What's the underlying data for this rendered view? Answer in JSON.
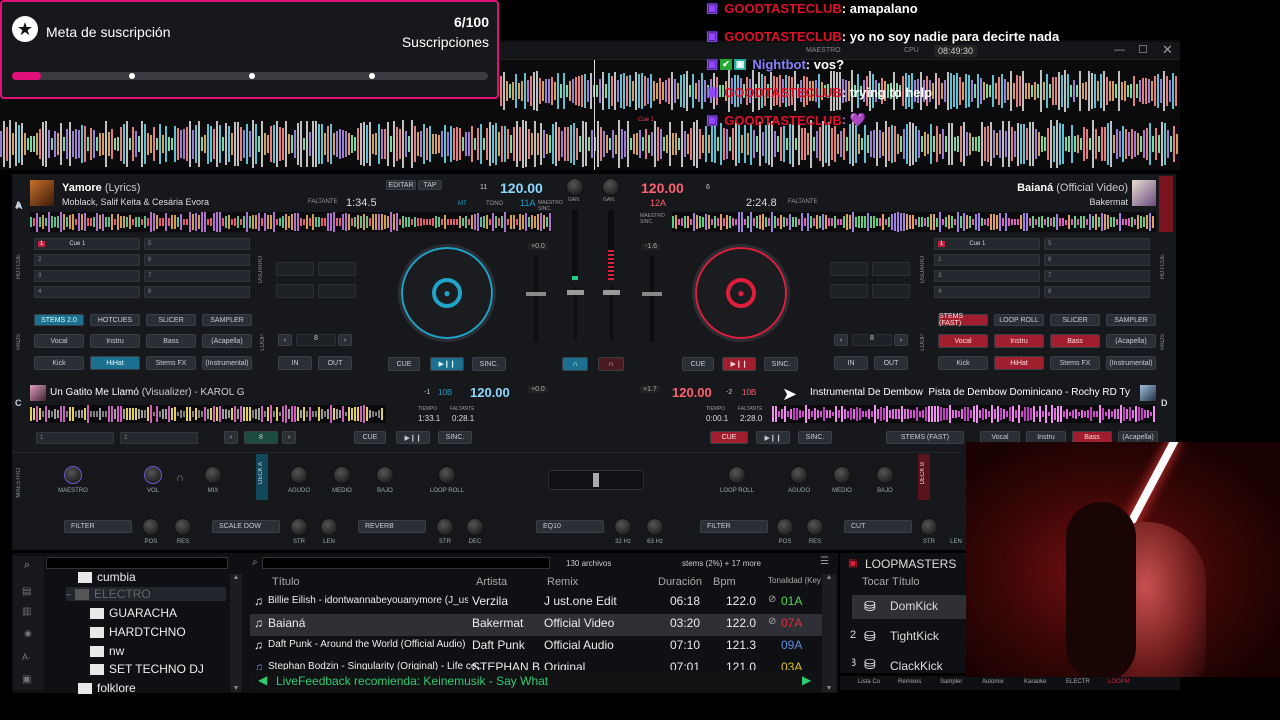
{
  "sub_goal": {
    "title": "Meta de suscripción",
    "count": "6/100",
    "unit": "Suscripciones",
    "progress": 0.06
  },
  "chat": [
    {
      "user": "GOODTASTECLUB",
      "text": ": amapalano"
    },
    {
      "user": "GOODTASTECLUB",
      "text": ": yo no soy nadie para decirte nada"
    },
    {
      "user": "Nightbot",
      "text": ": vos?"
    },
    {
      "user": "GOODTASTECLUB",
      "text": ": trying to help"
    },
    {
      "user": "GOODTASTECLUB",
      "text": ": 💜"
    }
  ],
  "topbar": {
    "master": "MAESTRO",
    "cpu": "CPU",
    "clock": "08:49:30"
  },
  "overview": {
    "cue_label": "Cue 1"
  },
  "deck_a": {
    "letter": "A",
    "title": "Yamore",
    "title_suffix": "(Lyrics)",
    "artist": "Moblack, Salif Keita & Cesária Evora",
    "remain_label": "FALTANTE",
    "remain": "1:34.5",
    "bpm": "120.00",
    "key": "11A",
    "edit": "EDITAR",
    "tap": "TAP",
    "mt": "MT",
    "tono": "TONO",
    "beat": "11",
    "sync_tag": "MAESTRO SINC."
  },
  "deck_b": {
    "letter": "B",
    "title": "Baianá",
    "title_suffix": "(Official Video)",
    "artist": "Bakermat",
    "remain_label": "FALTANTE",
    "remain": "2:24.8",
    "bpm": "120.00",
    "key": "12A",
    "beat": "6",
    "sync_tag": "MAESTRO SINC."
  },
  "deck_c": {
    "letter": "C",
    "title": "Un Gatito Me Llamó",
    "title_suffix": "(Visualizer) - KAROL G",
    "bpm": "120.00",
    "key": "10B",
    "offset": "-1",
    "tiempo_label": "TIEMPO",
    "faltante_label": "FALTANTE",
    "tiempo": "1:33.1",
    "faltante": "0:28.1"
  },
  "deck_d": {
    "letter": "D",
    "title": "Instrumental De Dembow",
    "title_suffix": "Pista de Dembow Dominicano - Rochy RD Ty",
    "bpm": "120.00",
    "key": "10B",
    "offset": "-2",
    "tiempo_label": "TIEMPO",
    "faltante_label": "FALTANTE",
    "tiempo": "0:00.1",
    "faltante": "2:28.0"
  },
  "cues_left": [
    "Cue 1",
    "",
    "",
    "",
    "",
    "",
    "",
    ""
  ],
  "cue_nums_left": [
    "1",
    "2",
    "3",
    "4",
    "5",
    "6",
    "7",
    "8"
  ],
  "cue_nums_right": [
    "1",
    "2",
    "3",
    "4",
    "5",
    "6",
    "7",
    "8"
  ],
  "cues_right": [
    "Cue 1",
    "",
    "",
    "",
    "",
    "",
    "",
    ""
  ],
  "pads_left": {
    "tabs": [
      "STEMS 2.0",
      "HOTCUES",
      "SLICER",
      "SAMPLER"
    ],
    "pads": [
      "Vocal",
      "Instru",
      "Bass",
      "(Acapella)",
      "Kick",
      "HiHat",
      "Stems FX",
      "(Instrumental)"
    ]
  },
  "pads_right": {
    "tabs": [
      "STEMS (FAST)",
      "LOOP ROLL",
      "SLICER",
      "SAMPLER"
    ],
    "pads": [
      "Vocal",
      "Instru",
      "Bass",
      "(Acapella)",
      "Kick",
      "HiHat",
      "Stems FX",
      "(Instrumental)"
    ]
  },
  "transport": {
    "cue": "CUE",
    "play": "▶❙❙",
    "sync": "SINC.",
    "in": "IN",
    "out": "OUT",
    "loop": "8"
  },
  "side_labels": {
    "hotcue": "HOTCUE",
    "pads": "PADS",
    "loop": "LOOP",
    "usuario": "USUARIO"
  },
  "mixer": {
    "gain": "GAN.",
    "pitch_a": "+0.0",
    "pitch_b": "-1.6",
    "pitch_c": "+0.0",
    "pitch_d": "+1.7"
  },
  "fx_left": {
    "knobs": [
      "MAESTRO",
      "VOL",
      "MIX"
    ],
    "eq": [
      "AGUDO",
      "MEDIO",
      "BAJO"
    ],
    "loop_roll": "LOOP ROLL",
    "filter": "FILTER",
    "scale": "SCALE DOW",
    "reverb": "REVERB",
    "k2": [
      "POS",
      "RES",
      "STR",
      "LEN",
      "STR",
      "DEC"
    ],
    "side": "MAESTRO",
    "deck": "DECK A"
  },
  "fx_right": {
    "loop_roll": "LOOP ROLL",
    "eq": [
      "AGUDO",
      "MEDIO",
      "BAJO"
    ],
    "eq10": "EQ10",
    "hz": [
      "32 Hz",
      "63 Hz"
    ],
    "filter": "FILTER",
    "cut": "CUT",
    "k2": [
      "POS",
      "RES",
      "STR",
      "LEN"
    ],
    "deck": "DECK B"
  },
  "bottom_row_c": {
    "stems": "STEMS (FAST)",
    "pads": [
      "Vocal",
      "Instru",
      "Bass",
      "(Acapella)"
    ]
  },
  "browser": {
    "folders": [
      "cumbia",
      "ELECTRO",
      "GUARACHA",
      "HARDTCHNO",
      "nw",
      "SET TECHNO DJ",
      "folklore"
    ],
    "count": "130 archivos",
    "stems_info": "stems (2%) + 17 more",
    "headers": [
      "Título",
      "Artista",
      "Remix",
      "Duración",
      "Bpm",
      "Tonalidad (Key"
    ],
    "rows": [
      {
        "title": "Billie Eilish - idontwannabeyouanymore (J_ust.o...",
        "artist": "Verzila",
        "remix": "J ust.one Edit",
        "dur": "06:18",
        "bpm": "122.0",
        "key": "01A"
      },
      {
        "title": "Baianá",
        "artist": "Bakermat",
        "remix": "Official Video",
        "dur": "03:20",
        "bpm": "122.0",
        "key": "07A"
      },
      {
        "title": "Daft Punk - Around the World (Official Audio)",
        "artist": "Daft Punk",
        "remix": "Official Audio",
        "dur": "07:10",
        "bpm": "121.3",
        "key": "09A"
      },
      {
        "title": "Stephan Bodzin - Singularity (Original) - Life ce...",
        "artist": "STEPHAN B",
        "remix": "Original",
        "dur": "07:01",
        "bpm": "121.0",
        "key": "03A"
      }
    ],
    "live_feedback": "LiveFeedback recomienda: Keinemusik - Say What"
  },
  "loopmasters": {
    "title": "LOOPMASTERS",
    "headers": [
      "Tocar",
      "Título"
    ],
    "items": [
      {
        "n": "",
        "name": "DomKick"
      },
      {
        "n": "2",
        "name": "TightKick"
      },
      {
        "n": "3",
        "name": "ClackKick"
      }
    ]
  },
  "bottom_tabs": [
    "Lista Co",
    "Remixes",
    "Sampler",
    "Automix",
    "Karaoke",
    "ELECTR",
    "LOOPM"
  ],
  "colors": {
    "accent_blue": "#1fa3c9",
    "accent_red": "#e01e3c",
    "twitch_purple": "#9146ff"
  }
}
